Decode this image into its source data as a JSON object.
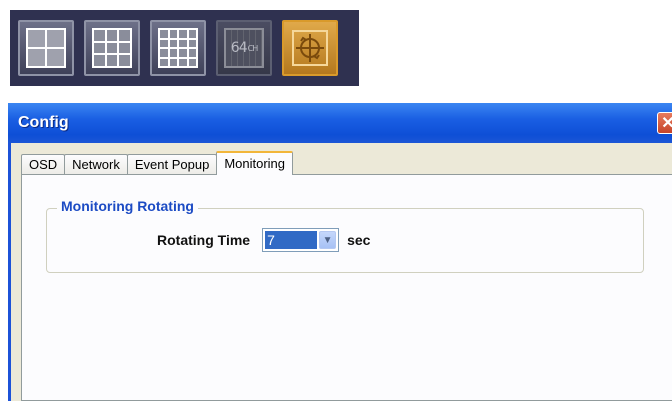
{
  "toolbar": {
    "buttons": [
      {
        "name": "layout-4-split",
        "icon": "grid-2x2-icon",
        "active": false
      },
      {
        "name": "layout-9-split",
        "icon": "grid-3x3-icon",
        "active": false
      },
      {
        "name": "layout-16-split",
        "icon": "grid-4x4-icon",
        "active": false
      },
      {
        "name": "layout-64-channel",
        "icon": "64ch-icon",
        "label": "64",
        "sublabel": "CH",
        "active": false
      },
      {
        "name": "config-rotate",
        "icon": "rotate-crosshair-icon",
        "active": true
      }
    ]
  },
  "window": {
    "title": "Config",
    "close_glyph": "✕",
    "tabs": [
      {
        "label": "OSD",
        "active": false
      },
      {
        "label": "Network",
        "active": false
      },
      {
        "label": "Event Popup",
        "active": false
      },
      {
        "label": "Monitoring",
        "active": true
      }
    ],
    "monitoring": {
      "group_title": "Monitoring Rotating",
      "rotating_time_label": "Rotating Time",
      "rotating_time_value": "7",
      "unit": "sec"
    }
  },
  "colors": {
    "titlebar": "#0e4fd6",
    "toolbar_bg": "#2f3150",
    "active_button": "#d99a2b",
    "group_title": "#1c4bc4",
    "selection": "#316ac5"
  }
}
